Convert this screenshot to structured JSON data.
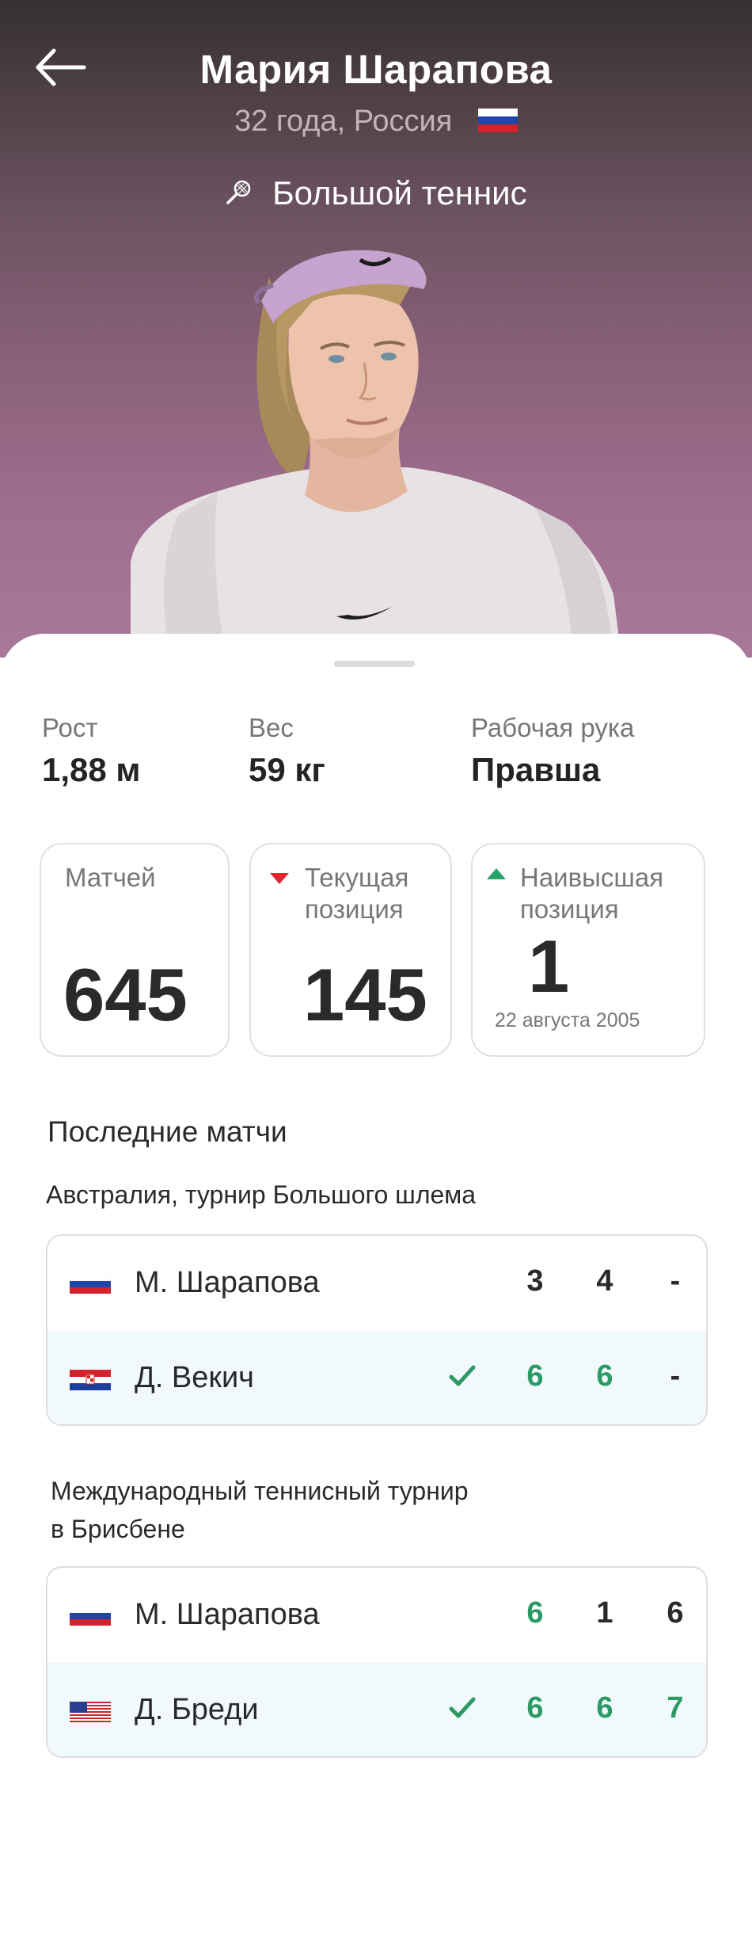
{
  "header": {
    "back_icon": "arrow-left-icon",
    "player_name": "Мария Шарапова",
    "subtitle": "32 года, Россия",
    "country_flag": "russia-flag-icon",
    "sport_icon": "tennis-racket-icon",
    "sport": "Большой теннис"
  },
  "stats": {
    "height_label": "Рост",
    "height_value": "1,88 м",
    "weight_label": "Вес",
    "weight_value": "59 кг",
    "hand_label": "Рабочая рука",
    "hand_value": "Правша"
  },
  "cards": {
    "matches_label": "Матчей",
    "matches_value": "645",
    "current_label_1": "Текущая",
    "current_label_2": "позиция",
    "current_value": "145",
    "current_trend": "down",
    "current_trend_color": "#e0252f",
    "best_label_1": "Наивысшая",
    "best_label_2": "позиция",
    "best_value": "1",
    "best_date": "22 августа 2005",
    "best_trend": "up",
    "best_trend_color": "#2aa36a"
  },
  "recent": {
    "title": "Последние матчи",
    "matches": [
      {
        "tournament_line1": "Австралия, турнир Большого шлема",
        "players": [
          {
            "flag": "russia-flag-icon",
            "name": "М. Шарапова",
            "winner": false,
            "scores": [
              "3",
              "4",
              "-"
            ]
          },
          {
            "flag": "croatia-flag-icon",
            "name": "Д. Векич",
            "winner": true,
            "scores": [
              "6",
              "6",
              "-"
            ]
          }
        ]
      },
      {
        "tournament_line1": "Международный теннисный турнир",
        "tournament_line2": "в Брисбене",
        "players": [
          {
            "flag": "russia-flag-icon",
            "name": "М. Шарапова",
            "winner": false,
            "scores": [
              "6",
              "1",
              "6"
            ]
          },
          {
            "flag": "usa-flag-icon",
            "name": "Д. Бреди",
            "winner": true,
            "scores": [
              "6",
              "6",
              "7"
            ]
          }
        ]
      }
    ]
  },
  "colors": {
    "win_green": "#2b9a64",
    "alt_row_bg": "#f2f9fc"
  }
}
